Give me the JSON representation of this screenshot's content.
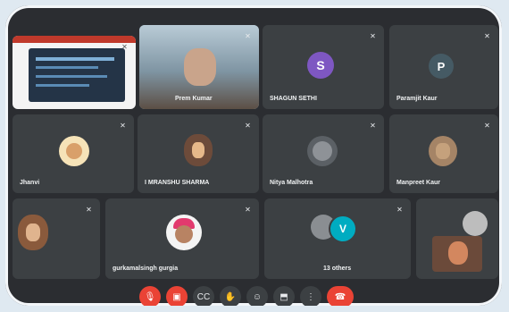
{
  "participants": [
    {
      "name": "",
      "mic": "muted"
    },
    {
      "name": "Prem Kumar",
      "mic": "muted"
    },
    {
      "name": "SHAGUN SETHI",
      "initial": "S",
      "color": "#7e57c2",
      "mic": "muted"
    },
    {
      "name": "Paramjit Kaur",
      "initial": "P",
      "color": "#455a64",
      "mic": "muted"
    },
    {
      "name": "Jhanvi",
      "mic": "muted"
    },
    {
      "name": "I MRANSHU SHARMA",
      "mic": "muted"
    },
    {
      "name": "Nitya Malhotra",
      "mic": "muted"
    },
    {
      "name": "Manpreet Kaur",
      "mic": "muted"
    },
    {
      "name": "",
      "mic": "muted"
    },
    {
      "name": "gurkamalsingh gurgia",
      "mic": "muted"
    },
    {
      "name": "13 others",
      "initial": "V",
      "color": "#00acc1",
      "mic": "muted"
    },
    {
      "name": "",
      "mic": "muted"
    }
  ],
  "controls": [
    {
      "icon": "mic-off-icon",
      "style": "red"
    },
    {
      "icon": "camera-off-icon",
      "style": "red"
    },
    {
      "icon": "captions-icon",
      "style": "normal"
    },
    {
      "icon": "raise-hand-icon",
      "style": "normal"
    },
    {
      "icon": "emoji-icon",
      "style": "normal"
    },
    {
      "icon": "present-icon",
      "style": "normal"
    },
    {
      "icon": "more-options-icon",
      "style": "normal"
    },
    {
      "icon": "end-call-icon",
      "style": "end"
    }
  ],
  "colors": {
    "frame": "#2b2d31",
    "tile": "#3c4043",
    "danger": "#ea4335"
  }
}
